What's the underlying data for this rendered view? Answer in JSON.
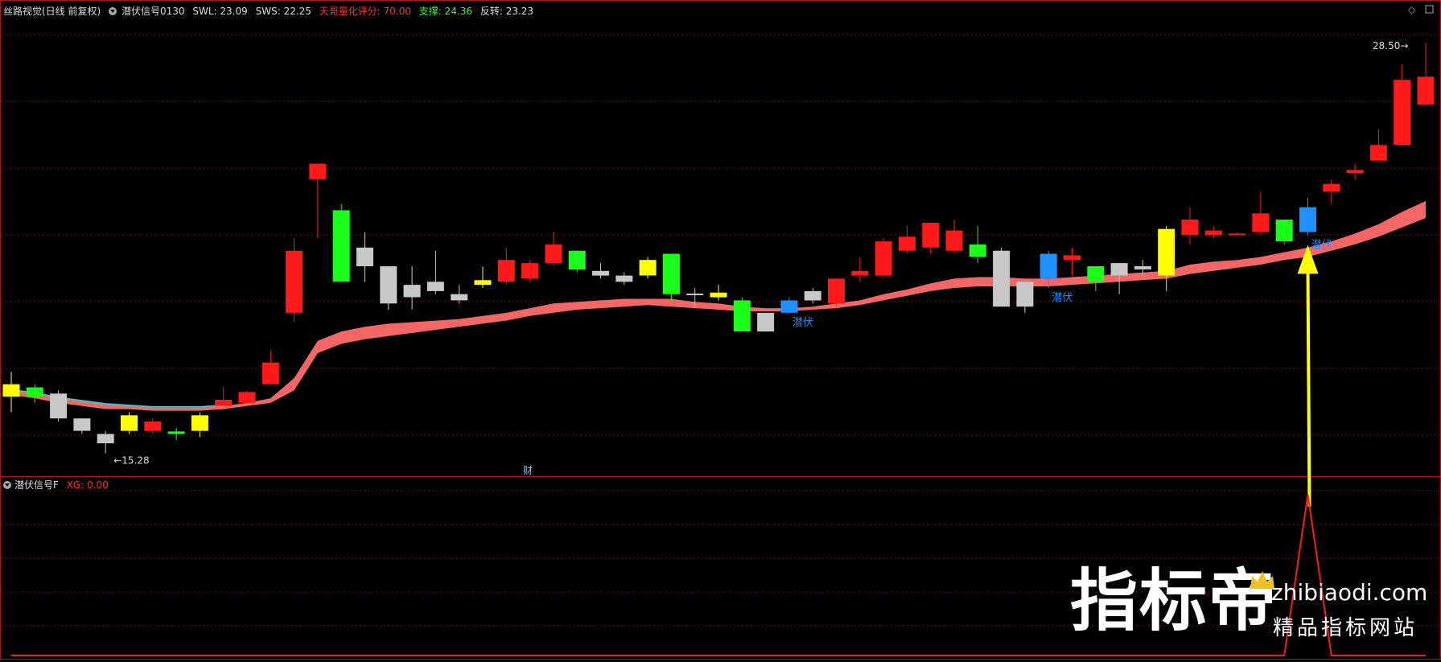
{
  "header": {
    "stock_name": "丝路视觉(日线 前复权)",
    "indicator_name": "潜伏信号0130",
    "swl": "SWL: 23.09",
    "sws": "SWS: 22.25",
    "score": "天哥量化评分: 70.00",
    "support": "支撑: 24.36",
    "reversal": "反转: 23.23"
  },
  "subpanel": {
    "indicator_name": "潜伏信号F",
    "xg": "XG: 0.00"
  },
  "annotations": {
    "low_label": "15.28",
    "high_label": "28.50",
    "cai_label": "财",
    "signal_label": "潜伏"
  },
  "watermark": {
    "brand": "指标帝",
    "url": "zhibiaodi.com",
    "tagline": "精品指标网站"
  },
  "colors": {
    "background": "#000000",
    "up": "#ff1a1a",
    "down": "#1aff1a",
    "neutral": "#c8c8c8",
    "yellow": "#ffff00",
    "signal_blue": "#1e90ff",
    "band": "#ff6b6b",
    "cyan_line": "#33cccc",
    "grid": "#7a1010",
    "arrow": "#ffff00",
    "xg_line": "#ff1a1a"
  },
  "chart_data": {
    "type": "candlestick",
    "price_range": [
      14.8,
      29.3
    ],
    "candles": [
      {
        "o": 17.1,
        "c": 17.5,
        "h": 17.9,
        "l": 16.6,
        "color": "yellow"
      },
      {
        "o": 17.1,
        "c": 17.4,
        "h": 17.5,
        "l": 16.9,
        "color": "green"
      },
      {
        "o": 16.4,
        "c": 17.2,
        "h": 17.3,
        "l": 16.3,
        "color": "gray"
      },
      {
        "o": 16.0,
        "c": 16.4,
        "h": 16.4,
        "l": 15.9,
        "color": "gray"
      },
      {
        "o": 15.6,
        "c": 15.9,
        "h": 16.0,
        "l": 15.28,
        "color": "gray"
      },
      {
        "o": 16.0,
        "c": 16.5,
        "h": 16.6,
        "l": 15.9,
        "color": "yellow"
      },
      {
        "o": 16.0,
        "c": 16.3,
        "h": 16.4,
        "l": 15.9,
        "color": "red"
      },
      {
        "o": 15.9,
        "c": 15.98,
        "h": 16.1,
        "l": 15.7,
        "color": "green"
      },
      {
        "o": 16.0,
        "c": 16.5,
        "h": 16.6,
        "l": 15.8,
        "color": "yellow"
      },
      {
        "o": 16.8,
        "c": 17.0,
        "h": 17.4,
        "l": 16.8,
        "color": "red"
      },
      {
        "o": 16.9,
        "c": 17.25,
        "h": 17.3,
        "l": 16.9,
        "color": "red"
      },
      {
        "o": 17.5,
        "c": 18.2,
        "h": 18.6,
        "l": 17.5,
        "color": "red"
      },
      {
        "o": 19.8,
        "c": 21.8,
        "h": 22.2,
        "l": 19.5,
        "color": "red"
      },
      {
        "o": 24.1,
        "c": 24.6,
        "h": 24.6,
        "l": 22.2,
        "color": "red"
      },
      {
        "o": 20.8,
        "c": 23.1,
        "h": 23.3,
        "l": 20.8,
        "color": "green"
      },
      {
        "o": 21.3,
        "c": 21.9,
        "h": 22.4,
        "l": 20.8,
        "color": "gray"
      },
      {
        "o": 20.1,
        "c": 21.3,
        "h": 21.3,
        "l": 19.9,
        "color": "gray"
      },
      {
        "o": 20.3,
        "c": 20.7,
        "h": 21.3,
        "l": 19.9,
        "color": "gray"
      },
      {
        "o": 20.5,
        "c": 20.8,
        "h": 21.8,
        "l": 20.4,
        "color": "gray"
      },
      {
        "o": 20.2,
        "c": 20.4,
        "h": 20.7,
        "l": 20.1,
        "color": "gray"
      },
      {
        "o": 20.7,
        "c": 20.85,
        "h": 21.3,
        "l": 20.6,
        "color": "yellow"
      },
      {
        "o": 20.8,
        "c": 21.5,
        "h": 21.9,
        "l": 20.7,
        "color": "red"
      },
      {
        "o": 20.9,
        "c": 21.4,
        "h": 21.5,
        "l": 20.8,
        "color": "red"
      },
      {
        "o": 21.4,
        "c": 22.0,
        "h": 22.4,
        "l": 21.3,
        "color": "red"
      },
      {
        "o": 21.2,
        "c": 21.8,
        "h": 21.8,
        "l": 21.1,
        "color": "green"
      },
      {
        "o": 21.0,
        "c": 21.15,
        "h": 21.4,
        "l": 20.9,
        "color": "gray"
      },
      {
        "o": 20.8,
        "c": 21.0,
        "h": 21.1,
        "l": 20.7,
        "color": "gray"
      },
      {
        "o": 21.0,
        "c": 21.5,
        "h": 21.6,
        "l": 20.9,
        "color": "yellow"
      },
      {
        "o": 20.4,
        "c": 21.7,
        "h": 21.7,
        "l": 20.2,
        "color": "green"
      },
      {
        "o": 20.4,
        "c": 20.42,
        "h": 20.6,
        "l": 20.0,
        "color": "gray"
      },
      {
        "o": 20.3,
        "c": 20.45,
        "h": 20.7,
        "l": 20.2,
        "color": "yellow"
      },
      {
        "o": 19.2,
        "c": 20.2,
        "h": 20.3,
        "l": 19.2,
        "color": "green"
      },
      {
        "o": 19.2,
        "c": 19.8,
        "h": 19.8,
        "l": 19.2,
        "color": "gray"
      },
      {
        "o": 19.8,
        "c": 20.2,
        "h": 20.3,
        "l": 19.8,
        "color": "blue"
      },
      {
        "o": 20.2,
        "c": 20.5,
        "h": 20.6,
        "l": 20.1,
        "color": "gray"
      },
      {
        "o": 20.1,
        "c": 20.9,
        "h": 20.9,
        "l": 20.0,
        "color": "red"
      },
      {
        "o": 21.0,
        "c": 21.15,
        "h": 21.6,
        "l": 20.8,
        "color": "red"
      },
      {
        "o": 21.0,
        "c": 22.1,
        "h": 22.2,
        "l": 20.9,
        "color": "red"
      },
      {
        "o": 21.8,
        "c": 22.25,
        "h": 22.6,
        "l": 21.7,
        "color": "red"
      },
      {
        "o": 21.9,
        "c": 22.7,
        "h": 22.7,
        "l": 21.7,
        "color": "red"
      },
      {
        "o": 21.8,
        "c": 22.45,
        "h": 22.8,
        "l": 21.7,
        "color": "red"
      },
      {
        "o": 21.6,
        "c": 22.0,
        "h": 22.6,
        "l": 21.4,
        "color": "green"
      },
      {
        "o": 20.0,
        "c": 21.8,
        "h": 21.9,
        "l": 20.0,
        "color": "gray"
      },
      {
        "o": 20.0,
        "c": 20.8,
        "h": 20.8,
        "l": 19.8,
        "color": "gray"
      },
      {
        "o": 20.9,
        "c": 21.7,
        "h": 21.8,
        "l": 20.6,
        "color": "blue"
      },
      {
        "o": 21.5,
        "c": 21.65,
        "h": 21.9,
        "l": 21.0,
        "color": "red"
      },
      {
        "o": 20.8,
        "c": 21.3,
        "h": 21.3,
        "l": 20.5,
        "color": "green"
      },
      {
        "o": 21.0,
        "c": 21.4,
        "h": 21.4,
        "l": 20.4,
        "color": "gray"
      },
      {
        "o": 21.2,
        "c": 21.3,
        "h": 21.5,
        "l": 21.0,
        "color": "gray"
      },
      {
        "o": 21.0,
        "c": 22.5,
        "h": 22.6,
        "l": 20.5,
        "color": "yellow"
      },
      {
        "o": 22.3,
        "c": 22.8,
        "h": 23.2,
        "l": 22.0,
        "color": "red"
      },
      {
        "o": 22.3,
        "c": 22.45,
        "h": 22.6,
        "l": 22.2,
        "color": "red"
      },
      {
        "o": 22.3,
        "c": 22.35,
        "h": 22.4,
        "l": 22.3,
        "color": "red"
      },
      {
        "o": 22.4,
        "c": 23.0,
        "h": 23.7,
        "l": 22.3,
        "color": "red"
      },
      {
        "o": 22.1,
        "c": 22.8,
        "h": 22.8,
        "l": 22.0,
        "color": "green"
      },
      {
        "o": 22.4,
        "c": 23.2,
        "h": 23.5,
        "l": 22.3,
        "color": "blue"
      },
      {
        "o": 23.7,
        "c": 23.95,
        "h": 24.1,
        "l": 23.3,
        "color": "red"
      },
      {
        "o": 24.3,
        "c": 24.4,
        "h": 24.6,
        "l": 24.1,
        "color": "red"
      },
      {
        "o": 24.7,
        "c": 25.2,
        "h": 25.7,
        "l": 24.7,
        "color": "red"
      },
      {
        "o": 25.2,
        "c": 27.3,
        "h": 27.8,
        "l": 25.2,
        "color": "red"
      },
      {
        "o": 26.5,
        "c": 27.4,
        "h": 28.5,
        "l": 26.5,
        "color": "red"
      }
    ],
    "band_upper": [
      17.3,
      17.2,
      17.05,
      16.95,
      16.85,
      16.8,
      16.75,
      16.75,
      16.75,
      16.8,
      16.9,
      17.05,
      17.7,
      18.9,
      19.2,
      19.35,
      19.45,
      19.5,
      19.55,
      19.6,
      19.7,
      19.8,
      19.95,
      20.1,
      20.15,
      20.2,
      20.25,
      20.25,
      20.25,
      20.15,
      20.1,
      20.0,
      19.95,
      19.95,
      20.0,
      20.1,
      20.2,
      20.4,
      20.55,
      20.75,
      20.9,
      20.95,
      20.95,
      20.9,
      20.9,
      20.95,
      21.0,
      21.05,
      21.1,
      21.15,
      21.35,
      21.45,
      21.5,
      21.6,
      21.75,
      21.9,
      22.1,
      22.35,
      22.65,
      23.05,
      23.4
    ],
    "band_lower": [
      17.15,
      17.05,
      16.9,
      16.8,
      16.7,
      16.7,
      16.65,
      16.65,
      16.65,
      16.7,
      16.8,
      16.9,
      17.3,
      18.5,
      18.8,
      18.95,
      19.05,
      19.15,
      19.25,
      19.35,
      19.45,
      19.55,
      19.7,
      19.8,
      19.9,
      19.95,
      20.0,
      20.05,
      20.0,
      19.95,
      19.9,
      19.85,
      19.85,
      19.85,
      19.9,
      19.95,
      20.05,
      20.2,
      20.35,
      20.5,
      20.6,
      20.65,
      20.65,
      20.65,
      20.65,
      20.7,
      20.75,
      20.8,
      20.85,
      20.9,
      21.05,
      21.15,
      21.25,
      21.35,
      21.5,
      21.6,
      21.8,
      22.0,
      22.25,
      22.55,
      22.85
    ],
    "signal_indices": [
      33,
      44,
      55
    ],
    "xg_values": [
      0,
      0,
      0,
      0,
      0,
      0,
      0,
      0,
      0,
      0,
      0,
      0,
      0,
      0,
      0,
      0,
      0,
      0,
      0,
      0,
      0,
      0,
      0,
      0,
      0,
      0,
      0,
      0,
      0,
      0,
      0,
      0,
      0,
      0,
      0,
      0,
      0,
      0,
      0,
      0,
      0,
      0,
      0,
      0,
      0,
      0,
      0,
      0,
      0,
      0,
      0,
      0,
      0,
      0,
      0,
      1,
      0,
      0,
      0,
      0,
      0
    ]
  }
}
